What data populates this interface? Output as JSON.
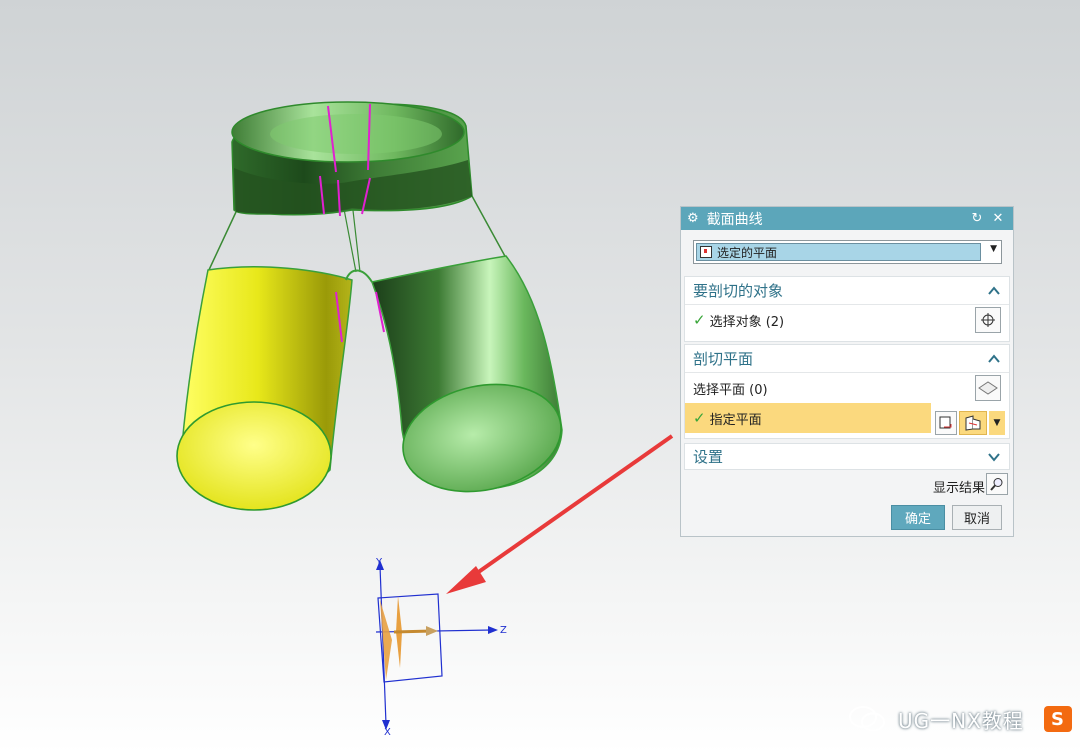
{
  "dialog": {
    "title": "截面曲线",
    "type_value": "选定的平面",
    "group_objects": {
      "title": "要剖切的对象",
      "select_label": "选择对象 (2)"
    },
    "group_plane": {
      "title": "剖切平面",
      "select_label": "选择平面 (0)",
      "specify_label": "指定平面"
    },
    "group_settings": {
      "title": "设置"
    },
    "show_result_label": "显示结果",
    "ok_label": "确定",
    "cancel_label": "取消"
  },
  "axes": {
    "y": "Y",
    "z": "Z",
    "x": "X"
  },
  "watermark": {
    "text": "UG一NX教程",
    "badge": "S"
  },
  "colors": {
    "dialog_title_bg": "#5ca6ba",
    "group_title": "#2f7289",
    "highlight_row": "#fbd97e",
    "ok_button": "#5fa8bd",
    "green_body": "#5fb85a",
    "yellow_leg": "#e6e61e",
    "section_line": "#e020d0",
    "pointer_arrow": "#e83a3a",
    "csys_axes": "#2030d0",
    "plane_vector": "#e8a040"
  },
  "icons": [
    "gear-icon",
    "reset-icon",
    "close-icon",
    "dropdown-arrow-icon",
    "chevron-up-icon",
    "chevron-down-icon",
    "crosshair-icon",
    "plane-icon",
    "plane-specify-icon",
    "magnifier-icon"
  ]
}
